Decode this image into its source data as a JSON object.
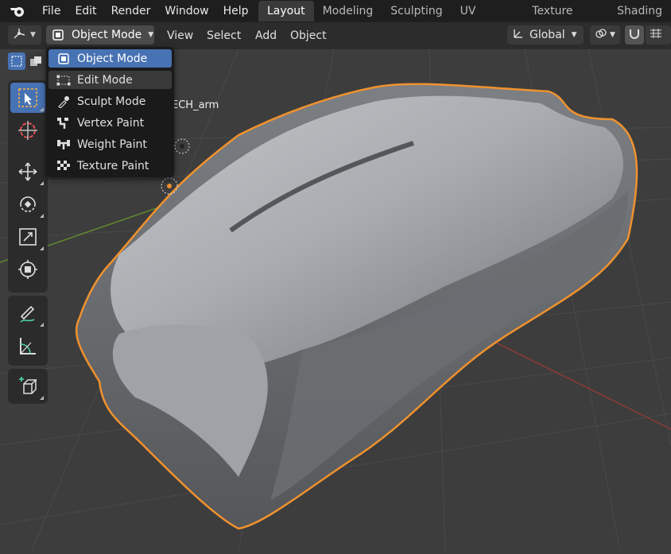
{
  "topbar": {
    "menus": [
      "File",
      "Edit",
      "Render",
      "Window",
      "Help"
    ],
    "tabs": [
      "Layout",
      "Modeling",
      "Sculpting",
      "UV Editing",
      "Texture Paint",
      "Shading"
    ],
    "active_tab": "Layout"
  },
  "header": {
    "mode_label": "Object Mode",
    "menus": [
      "View",
      "Select",
      "Add",
      "Object"
    ],
    "transform_orientation": "Global"
  },
  "mode_menu": {
    "items": [
      {
        "label": "Object Mode",
        "icon": "object-mode-icon",
        "state": "selected"
      },
      {
        "label": "Edit Mode",
        "icon": "edit-mode-icon",
        "state": "hover"
      },
      {
        "label": "Sculpt Mode",
        "icon": "sculpt-mode-icon",
        "state": ""
      },
      {
        "label": "Vertex Paint",
        "icon": "vertex-paint-icon",
        "state": ""
      },
      {
        "label": "Weight Paint",
        "icon": "weight-paint-icon",
        "state": ""
      },
      {
        "label": "Texture Paint",
        "icon": "texture-paint-icon",
        "state": ""
      }
    ]
  },
  "viewport": {
    "object_label": "ECH_arm"
  },
  "toolbar": {
    "tools": [
      "select-box-icon",
      "cursor-icon",
      "move-icon",
      "rotate-icon",
      "scale-icon",
      "transform-icon",
      "annotate-icon",
      "measure-icon",
      "add-cube-icon"
    ],
    "active_tool": "select-box-icon"
  },
  "colors": {
    "accent": "#4772b3",
    "selection_outline": "#f0922e",
    "x_axis": "#8a3a3a",
    "y_axis": "#5f8a2c",
    "viewport_bg": "#3d3d3d"
  }
}
